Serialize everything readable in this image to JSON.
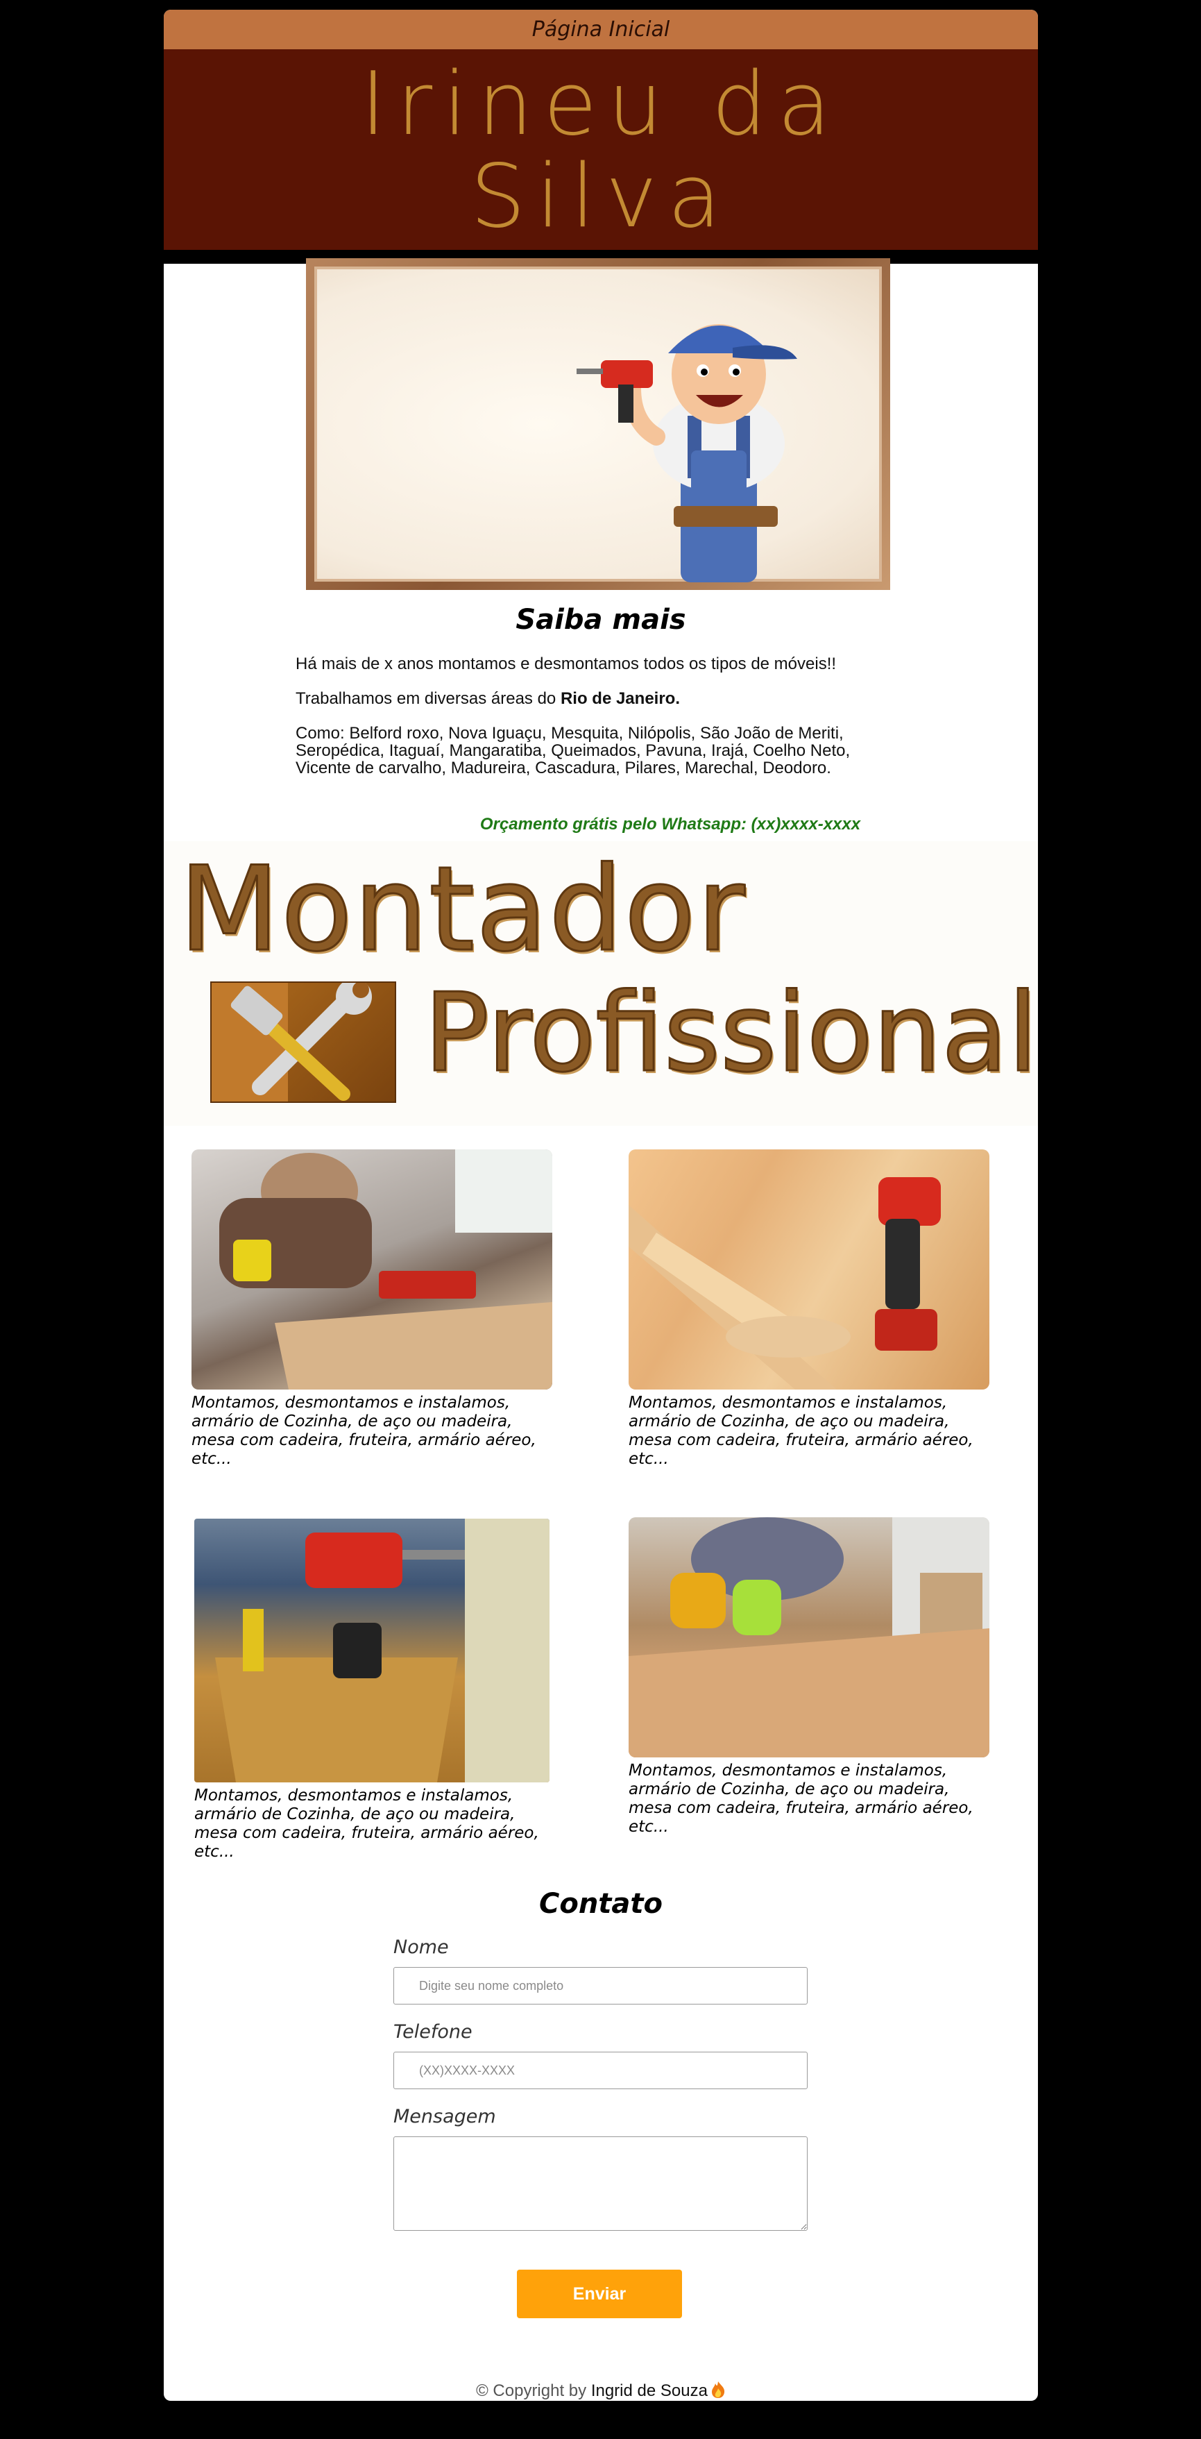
{
  "nav": {
    "home_label": "Página Inicial"
  },
  "hero": {
    "title": "Irineu da Silva"
  },
  "about": {
    "heading": "Saiba mais",
    "p1": "Há mais de x anos montamos e desmontamos todos os tipos de móveis!!",
    "p2_prefix": "Trabalhamos em diversas áreas do ",
    "p2_bold": "Rio de Janeiro.",
    "p3": "Como: Belford roxo, Nova Iguaçu, Mesquita, Nilópolis, São João de Meriti, Seropédica, Itaguaí, Mangaratiba, Queimados, Pavuna, Irajá, Coelho Neto, Vicente de carvalho, Madureira, Cascadura, Pilares, Marechal, Deodoro."
  },
  "cta": {
    "quote": "Orçamento grátis pelo Whatsapp: (xx)xxxx-xxxx"
  },
  "banner": {
    "word1": "Montador",
    "word2": "Profissional",
    "icon": "hammer-wrench-icon"
  },
  "services": [
    {
      "caption": "Montamos, desmontamos e instalamos, armário de Cozinha, de aço ou madeira, mesa com cadeira, fruteira, armário aéreo, etc..."
    },
    {
      "caption": "Montamos, desmontamos e instalamos, armário de Cozinha, de aço ou madeira, mesa com cadeira, fruteira, armário aéreo, etc..."
    },
    {
      "caption": "Montamos, desmontamos e instalamos, armário de Cozinha, de aço ou madeira, mesa com cadeira, fruteira, armário aéreo, etc..."
    },
    {
      "caption": "Montamos, desmontamos e instalamos, armário de Cozinha, de aço ou madeira, mesa com cadeira, fruteira, armário aéreo, etc..."
    }
  ],
  "contact": {
    "heading": "Contato",
    "name_label": "Nome",
    "name_placeholder": "Digite seu nome completo",
    "phone_label": "Telefone",
    "phone_placeholder": "(XX)XXXX-XXXX",
    "message_label": "Mensagem",
    "message_value": "",
    "send_label": "Enviar"
  },
  "footer": {
    "prefix": "© Copyright by ",
    "author": "Ingrid de Souza",
    "icon": "fire-icon"
  },
  "colors": {
    "nav_bg": "#c07340",
    "hero_bg": "#5a1404",
    "hero_text": "#c38a33",
    "cta_green": "#1f7a16",
    "button": "#ffa20a"
  }
}
